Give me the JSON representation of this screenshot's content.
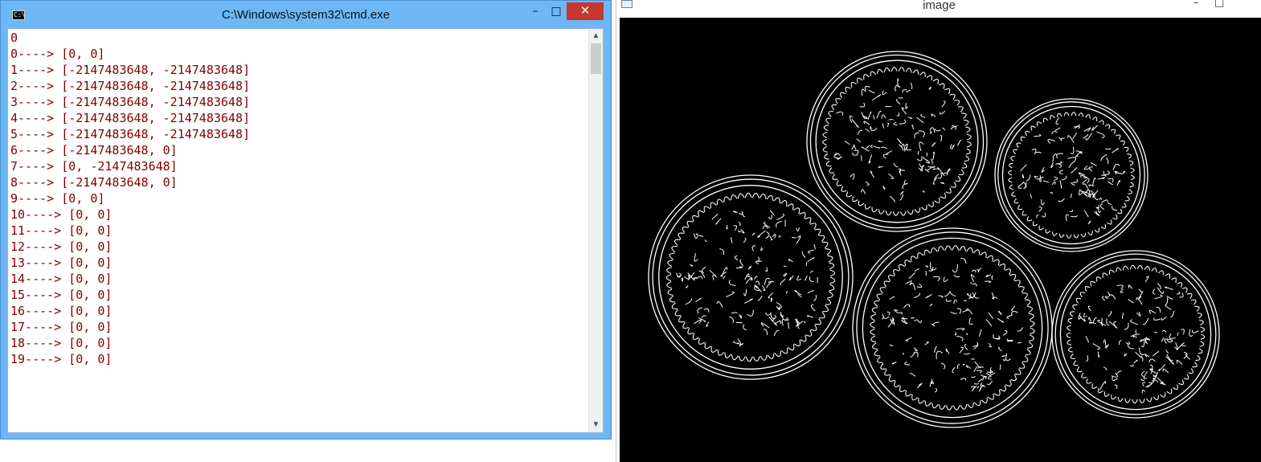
{
  "cmd_window": {
    "title": "C:\\Windows\\system32\\cmd.exe",
    "icon_text": "C:\\",
    "text_color": "#800000",
    "controls": {
      "minimize": "–",
      "maximize": "□",
      "close": "✕"
    },
    "lines": [
      "0",
      "0----> [0, 0]",
      "1----> [-2147483648, -2147483648]",
      "2----> [-2147483648, -2147483648]",
      "3----> [-2147483648, -2147483648]",
      "4----> [-2147483648, -2147483648]",
      "5----> [-2147483648, -2147483648]",
      "6----> [-2147483648, 0]",
      "7----> [0, -2147483648]",
      "8----> [-2147483648, 0]",
      "9----> [0, 0]",
      "10----> [0, 0]",
      "11----> [0, 0]",
      "12----> [0, 0]",
      "13----> [0, 0]",
      "14----> [0, 0]",
      "15----> [0, 0]",
      "16----> [0, 0]",
      "17----> [0, 0]",
      "18----> [0, 0]",
      "19----> [0, 0]"
    ],
    "scrollbar": {
      "up_arrow": "▲",
      "down_arrow": "▼"
    }
  },
  "image_window": {
    "title": "image",
    "controls": {
      "minimize": "–",
      "maximize": "□"
    },
    "content": "canny-edge coins image"
  }
}
